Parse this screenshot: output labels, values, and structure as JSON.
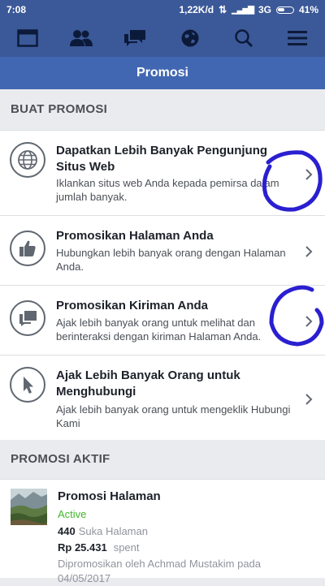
{
  "status_bar": {
    "time": "7:08",
    "speed": "1,22K/d",
    "network": "3G",
    "battery": "41%"
  },
  "nav": {
    "icons": [
      "news-feed-icon",
      "friends-icon",
      "messages-icon",
      "notifications-globe-icon",
      "search-icon",
      "menu-icon"
    ]
  },
  "page": {
    "title": "Promosi"
  },
  "sections": {
    "create": "BUAT PROMOSI",
    "active": "PROMOSI AKTIF"
  },
  "options": [
    {
      "title": "Dapatkan Lebih Banyak Pengunjung Situs Web",
      "desc": "Iklankan situs web Anda kepada pemirsa dalam jumlah banyak.",
      "icon": "globe-icon"
    },
    {
      "title": "Promosikan Halaman Anda",
      "desc": "Hubungkan lebih banyak orang dengan Halaman Anda.",
      "icon": "thumbs-up-icon"
    },
    {
      "title": "Promosikan Kiriman Anda",
      "desc": "Ajak lebih banyak orang untuk melihat dan berinteraksi dengan kiriman Halaman Anda.",
      "icon": "post-icon"
    },
    {
      "title": "Ajak Lebih Banyak Orang untuk Menghubungi",
      "desc": "Ajak lebih banyak orang untuk mengeklik Hubungi Kami",
      "icon": "cursor-icon"
    }
  ],
  "active_promo": {
    "title": "Promosi Halaman",
    "status": "Active",
    "likes": "440",
    "likes_label": "Suka Halaman",
    "spent": "Rp 25.431",
    "spent_label": "spent",
    "promoted_by": "Dipromosikan oleh Achmad Mustakim pada",
    "date": "04/05/2017"
  },
  "colors": {
    "brand": "#3b5998",
    "title_bar": "#4267b2",
    "active_green": "#42b72a",
    "annotation_ink": "#2a1fd0"
  }
}
